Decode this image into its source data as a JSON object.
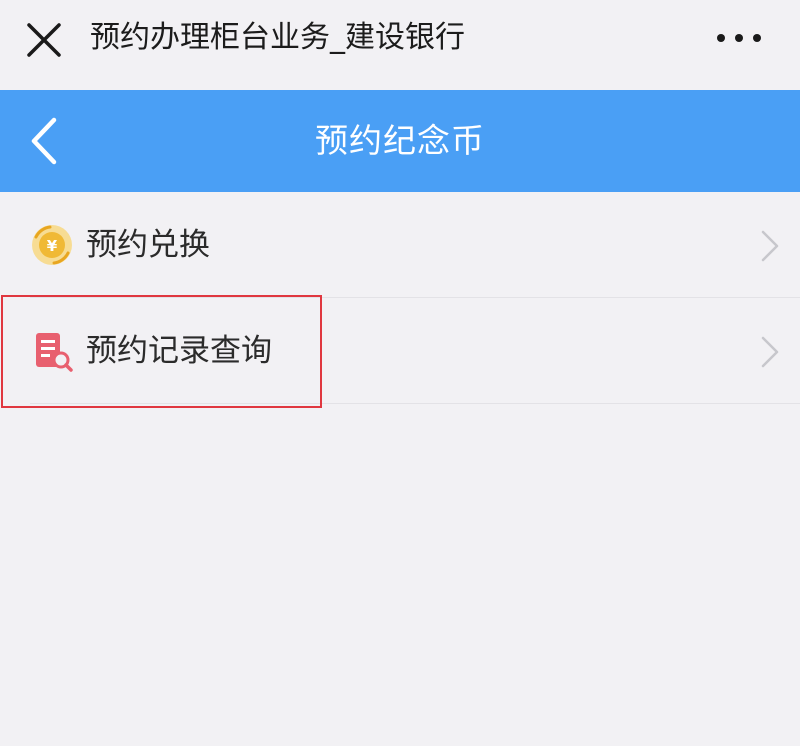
{
  "window": {
    "title": "预约办理柜台业务_建设银行",
    "close_icon": "close-icon",
    "more_icon": "more-icon"
  },
  "header": {
    "title": "预约纪念币",
    "back_icon": "back-chevron-icon",
    "background_color": "#4a9ff5"
  },
  "menu": {
    "items": [
      {
        "label": "预约兑换",
        "icon": "coin-exchange-icon",
        "icon_color": "#f0c44a"
      },
      {
        "label": "预约记录查询",
        "icon": "record-search-icon",
        "icon_color": "#e8606f"
      }
    ],
    "chevron_icon": "chevron-right-icon"
  },
  "highlight": {
    "color": "#e0373f",
    "target": "预约记录查询"
  }
}
